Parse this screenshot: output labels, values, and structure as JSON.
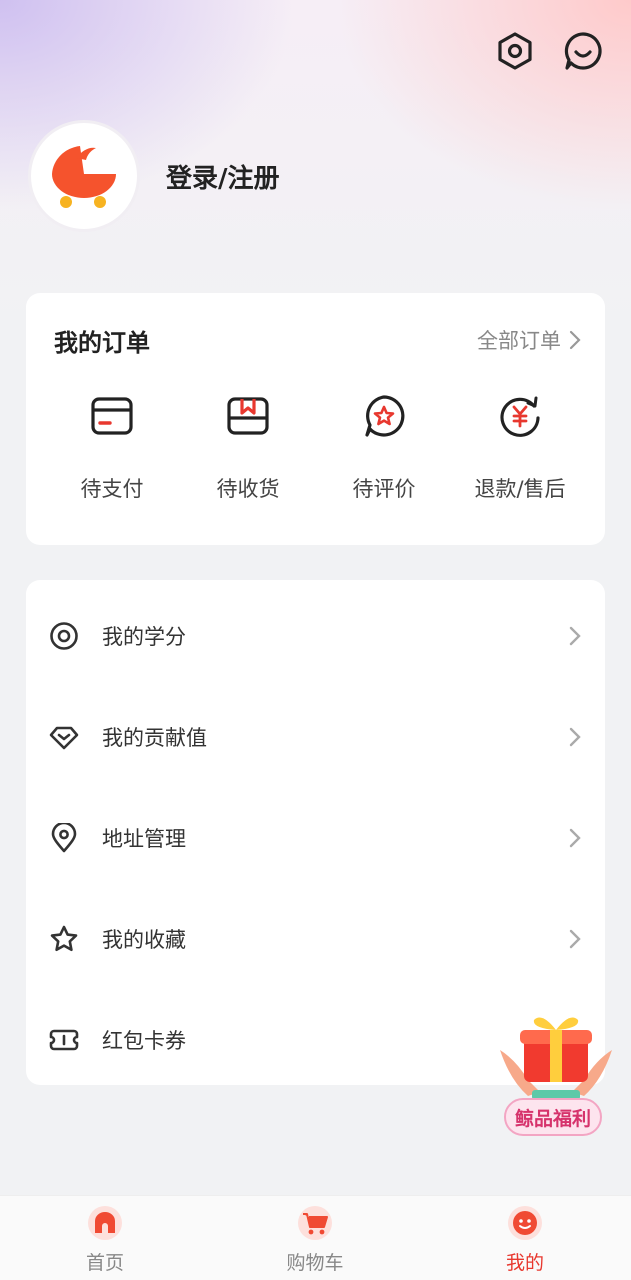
{
  "header": {
    "login_label": "登录/注册",
    "icons": [
      "settings-hex-icon",
      "customer-service-icon"
    ]
  },
  "orders": {
    "title": "我的订单",
    "all_label": "全部订单",
    "items": [
      {
        "label": "待支付",
        "icon": "card-icon"
      },
      {
        "label": "待收货",
        "icon": "package-icon"
      },
      {
        "label": "待评价",
        "icon": "review-star-icon"
      },
      {
        "label": "退款/售后",
        "icon": "refund-icon"
      }
    ]
  },
  "menu": {
    "items": [
      {
        "label": "我的学分",
        "icon": "target-icon"
      },
      {
        "label": "我的贡献值",
        "icon": "diamond-icon"
      },
      {
        "label": "地址管理",
        "icon": "location-pin-icon"
      },
      {
        "label": "我的收藏",
        "icon": "star-icon"
      },
      {
        "label": "红包卡券",
        "icon": "coupon-icon"
      }
    ]
  },
  "floating": {
    "label": "鲸品福利"
  },
  "tabbar": {
    "items": [
      {
        "label": "首页",
        "active": false
      },
      {
        "label": "购物车",
        "active": false
      },
      {
        "label": "我的",
        "active": true
      }
    ]
  },
  "colors": {
    "accent": "#e8382f",
    "orange": "#f5532d"
  }
}
